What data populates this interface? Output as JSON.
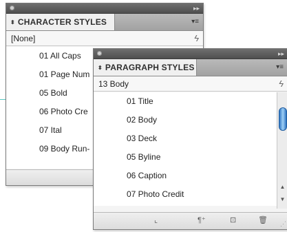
{
  "character_styles_panel": {
    "tab_label": "CHARACTER STYLES",
    "current_style": "[None]",
    "items": [
      "01 All Caps",
      "01 Page Num",
      "05 Bold",
      "06 Photo Cre",
      "07 Ital",
      "09 Body Run-"
    ]
  },
  "paragraph_styles_panel": {
    "tab_label": "PARAGRAPH STYLES",
    "current_style": "13 Body",
    "items": [
      "01 Title",
      "02 Body",
      "03 Deck",
      "05 Byline",
      "06 Caption",
      "07 Photo Credit"
    ]
  },
  "icons": {
    "collapse": "collapse-icon",
    "panel_menu": "panel-menu-icon",
    "lightning": "lightning-icon",
    "clear_overrides": "clear-overrides-icon",
    "new_style_group": "new-style-group-icon",
    "new_style": "new-style-icon",
    "delete_style": "trash-icon"
  }
}
